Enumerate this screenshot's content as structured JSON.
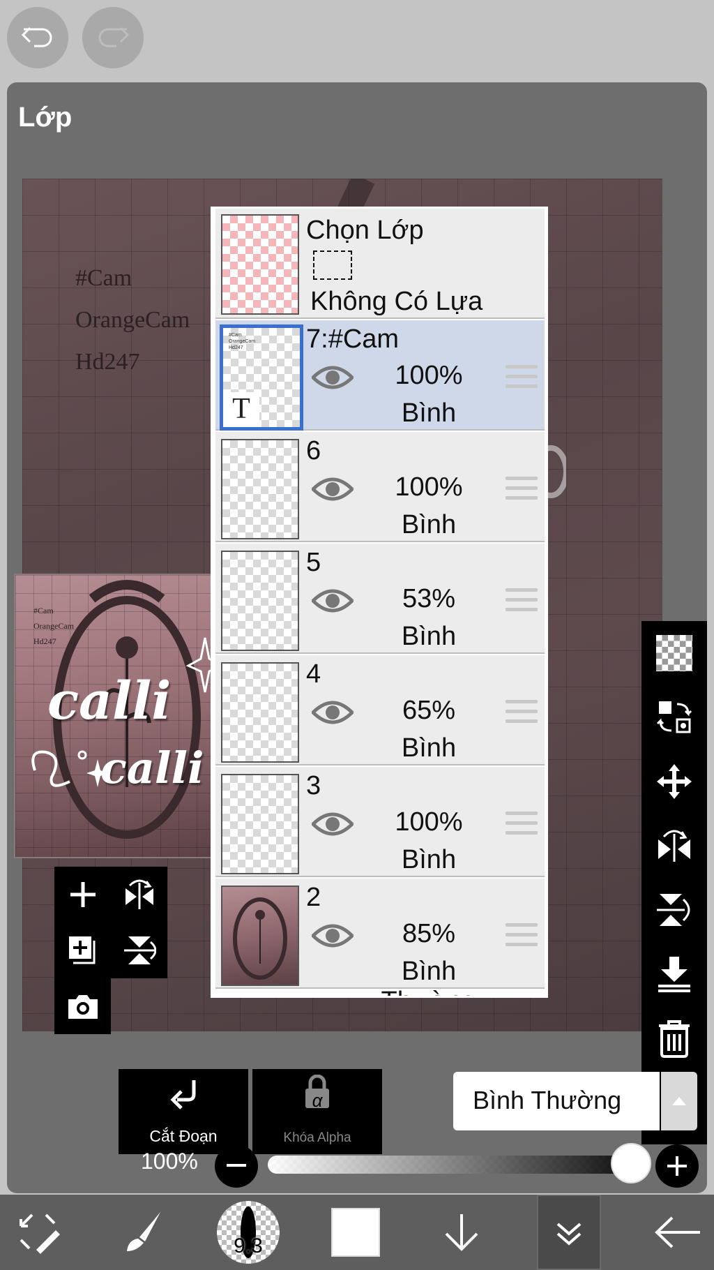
{
  "panel": {
    "title": "Lớp"
  },
  "canvas": {
    "lines": [
      "#Cam",
      "OrangeCam",
      "Hd247"
    ]
  },
  "thumbnail": {
    "lines": [
      "#Cam",
      "OrangeCam",
      "Hd247"
    ],
    "art_text_1": "calli",
    "art_text_2": "calli"
  },
  "selection_layer": {
    "title": "Chọn Lớp",
    "status": "Không Có Lựa Chọn"
  },
  "layers": [
    {
      "name": "7:#Cam",
      "opacity": "100%",
      "blend": "Bình Thường",
      "selected": true,
      "thumb_letter": "T"
    },
    {
      "name": "6",
      "opacity": "100%",
      "blend": "Bình Thường",
      "selected": false
    },
    {
      "name": "5",
      "opacity": "53%",
      "blend": "Bình Thường",
      "selected": false
    },
    {
      "name": "4",
      "opacity": "65%",
      "blend": "Bình Thường",
      "selected": false
    },
    {
      "name": "3",
      "opacity": "100%",
      "blend": "Bình Thường",
      "selected": false
    },
    {
      "name": "2",
      "opacity": "85%",
      "blend": "Bình Thường",
      "selected": false
    }
  ],
  "controls": {
    "clipping_label": "Cắt Đoạn",
    "alpha_lock_label": "Khóa Alpha",
    "alpha_symbol": "α",
    "blend_mode": "Bình Thường",
    "opacity_label": "100%",
    "opacity_value": 1.0
  },
  "bottom_bar": {
    "brush_size": "9.3"
  },
  "colors": {
    "selected_row": "#cfd8e8",
    "selected_border": "#3b6fcf",
    "panel_bg": "#6e6e6e"
  }
}
